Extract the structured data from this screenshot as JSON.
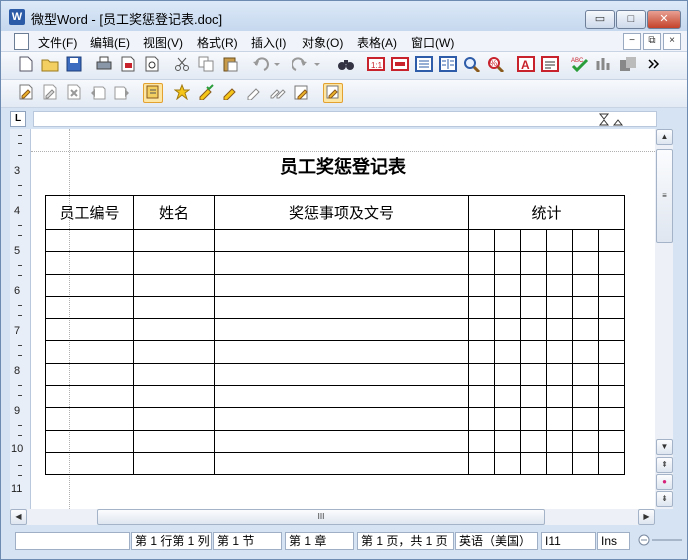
{
  "window": {
    "title": "微型Word - [员工奖惩登记表.doc]",
    "app_icon_letter": "W",
    "minimize": "▭",
    "maximize": "□",
    "close": "✕"
  },
  "menu": {
    "items": [
      "文件(F)",
      "编辑(E)",
      "视图(V)",
      "格式(R)",
      "插入(I)",
      "对象(O)",
      "表格(A)",
      "窗口(W)"
    ],
    "mdi_minimize": "−",
    "mdi_restore": "⧉",
    "mdi_close": "×"
  },
  "toolbar1_icons": [
    "new-icon",
    "open-icon",
    "save-icon",
    "print-icon",
    "pdf-icon",
    "print-preview-icon",
    "cut-icon",
    "copy-icon",
    "paste-icon",
    "undo-icon",
    "redo-icon",
    "find-icon",
    "page-width-icon",
    "text-box-icon",
    "page-view-icon",
    "full-page-icon",
    "zoom-icon",
    "zoom-percent-icon",
    "font-color-icon",
    "format-icon",
    "spell-check-icon",
    "columns-icon",
    "gray-icon",
    "more-icon"
  ],
  "toolbar2_icons": [
    "track-icon",
    "edit-pen-icon",
    "delete-mark-icon",
    "prev-change-icon",
    "next-change-icon",
    "accept-icon",
    "star-icon",
    "check-pen-icon",
    "pen-icon",
    "pen-outline-icon",
    "pen-double-icon",
    "note-edit-icon",
    "review-icon"
  ],
  "document": {
    "title": "员工奖惩登记表",
    "table_headers": [
      "员工编号",
      "姓名",
      "奖惩事项及文号",
      "统计"
    ],
    "stat_subcolumns": 6,
    "data_rows": 11
  },
  "vertical_ruler": [
    "3",
    "4",
    "5",
    "6",
    "7",
    "8",
    "9",
    "10",
    "11"
  ],
  "scroll": {
    "up": "▲",
    "down": "▼",
    "left": "◀",
    "right": "▶",
    "grip_v": "≡",
    "grip_h": "III",
    "page_up": "⇞",
    "browse": "●",
    "page_down": "⇟"
  },
  "status": {
    "line_col": "第 1 行第 1 列",
    "section": "第 1 节",
    "chapter": "第 1 章",
    "page": "第 1 页，共 1 页",
    "language": "英语（美国）",
    "position": "I11",
    "mode": "Ins"
  }
}
